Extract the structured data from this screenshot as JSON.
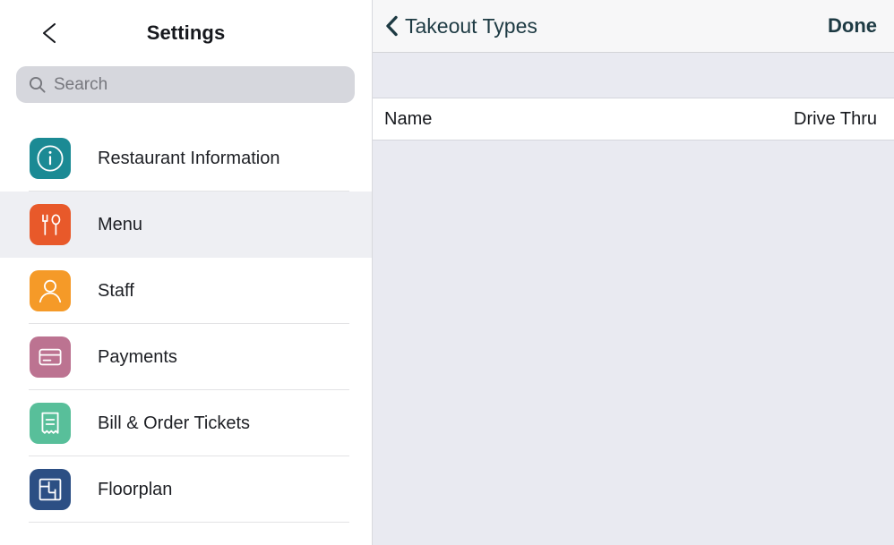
{
  "sidebar": {
    "back_icon": "chevron-left-icon",
    "title": "Settings",
    "search": {
      "icon": "search-icon",
      "placeholder": "Search",
      "value": ""
    },
    "items": [
      {
        "label": "Restaurant Information",
        "icon": "info-circle-icon",
        "color": "#1b8a94",
        "selected": false
      },
      {
        "label": "Menu",
        "icon": "fork-spoon-icon",
        "color": "#e8592a",
        "selected": true
      },
      {
        "label": "Staff",
        "icon": "person-icon",
        "color": "#f59a28",
        "selected": false
      },
      {
        "label": "Payments",
        "icon": "credit-card-icon",
        "color": "#bc7391",
        "selected": false
      },
      {
        "label": "Bill & Order Tickets",
        "icon": "receipt-icon",
        "color": "#58bf9a",
        "selected": false
      },
      {
        "label": "Floorplan",
        "icon": "floorplan-icon",
        "color": "#2c4f84",
        "selected": false
      }
    ]
  },
  "detail": {
    "back_icon": "chevron-left-icon",
    "back_label": "Takeout Types",
    "done_label": "Done",
    "fields": [
      {
        "label": "Name",
        "value": "Drive Thru"
      }
    ]
  },
  "colors": {
    "nav_text": "#1d3a43",
    "panel_background": "#e9eaf1",
    "selected_row": "#eeeff3",
    "search_background": "#d6d7dd"
  }
}
